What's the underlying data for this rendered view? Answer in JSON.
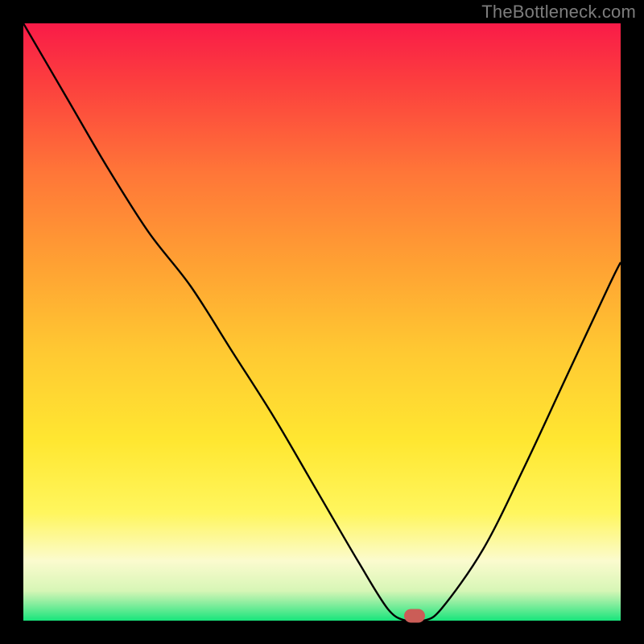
{
  "attribution": "TheBottleneck.com",
  "chart_data": {
    "type": "line",
    "title": "",
    "xlabel": "",
    "ylabel": "",
    "xlim": [
      0,
      100
    ],
    "ylim": [
      0,
      100
    ],
    "background": "rainbow-gradient-red-to-green",
    "green_band": {
      "from_pct": 97.0,
      "to_pct": 100.0
    },
    "marker": {
      "x": 65.5,
      "y": 100
    },
    "series": [
      {
        "name": "bottleneck-curve",
        "x": [
          0,
          7,
          14,
          21,
          28,
          35,
          42,
          49,
          56,
          61,
          64,
          67,
          70,
          77,
          84,
          91,
          98,
          100
        ],
        "y": [
          0,
          12,
          24,
          35,
          44,
          55,
          66,
          78,
          90,
          98,
          100,
          100,
          98,
          88,
          74,
          59,
          44,
          40
        ]
      }
    ],
    "colors": {
      "background_top": "#f91b48",
      "background_mid1": "#ffa033",
      "background_mid2": "#ffe731",
      "background_pale": "#fbfbce",
      "background_green": "#18e57c",
      "curve": "#000000",
      "marker": "#cb5d57",
      "frame": "#000000",
      "attribution": "#7d7d7d"
    }
  }
}
